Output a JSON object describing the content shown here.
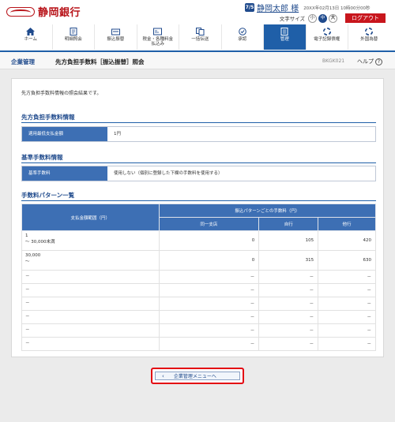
{
  "header": {
    "bank_name": "静岡銀行",
    "user_id_badge": "7/5",
    "user_name": "静岡太郎 様",
    "login_time": "20XX年02月13日 10時00分00秒",
    "font_size_label": "文字サイズ",
    "font_sizes": [
      "小",
      "中",
      "大"
    ],
    "logout_label": "ログアウト"
  },
  "nav": [
    {
      "label": "ホーム",
      "icon": "home-icon"
    },
    {
      "label": "明細照会",
      "icon": "statement-icon"
    },
    {
      "label": "振込振替",
      "icon": "transfer-icon"
    },
    {
      "label": "税金・各種料金\n払込み",
      "icon": "tax-payment-icon"
    },
    {
      "label": "一括伝送",
      "icon": "bulk-transmission-icon"
    },
    {
      "label": "承認",
      "icon": "approval-icon"
    },
    {
      "label": "管理",
      "icon": "management-icon"
    },
    {
      "label": "電子記録債権",
      "icon": "electronic-claim-icon"
    },
    {
      "label": "外国為替",
      "icon": "forex-icon"
    }
  ],
  "colors": {
    "brand": "#b8141a",
    "nav_active": "#1f5fa8",
    "table_header": "#3d6fb4",
    "highlight_border": "#e30613"
  },
  "titlebar": {
    "section": "企業管理",
    "page_title": "先方負担手数料［振込振替］照会",
    "screen_id": "BKGK021",
    "help": "ヘルプ"
  },
  "content": {
    "intro": "先方負担手数料情報の照会結果です。",
    "fee_info": {
      "heading": "先方負担手数料情報",
      "key": "適用最低支払金額",
      "value": "1円"
    },
    "base_fee": {
      "heading": "基準手数料情報",
      "key": "基準手数料",
      "value": "使用しない（個別に登録した下欄の手数料を使用する）"
    },
    "pattern": {
      "heading": "手数料パターン一覧",
      "col_range": "支払金額範囲（円）",
      "col_group": "振込パターンごとの手数料（円）",
      "cols": [
        "同一支店",
        "自行",
        "他行"
      ],
      "rows": [
        {
          "range_a": "1",
          "range_b": "～ 30,000未満",
          "v": [
            "0",
            "105",
            "420"
          ]
        },
        {
          "range_a": "30,000",
          "range_b": "～",
          "v": [
            "0",
            "315",
            "630"
          ]
        },
        {
          "range_a": "－",
          "range_b": "",
          "v": [
            "－",
            "－",
            "－"
          ]
        },
        {
          "range_a": "－",
          "range_b": "",
          "v": [
            "－",
            "－",
            "－"
          ]
        },
        {
          "range_a": "－",
          "range_b": "",
          "v": [
            "－",
            "－",
            "－"
          ]
        },
        {
          "range_a": "－",
          "range_b": "",
          "v": [
            "－",
            "－",
            "－"
          ]
        },
        {
          "range_a": "－",
          "range_b": "",
          "v": [
            "－",
            "－",
            "－"
          ]
        },
        {
          "range_a": "－",
          "range_b": "",
          "v": [
            "－",
            "－",
            "－"
          ]
        }
      ]
    },
    "back_button": "企業管理メニューへ"
  }
}
